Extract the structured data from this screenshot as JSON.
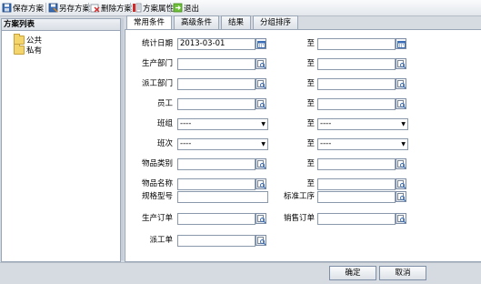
{
  "toolbar": {
    "save_label": "保存方案",
    "save_as_label": "另存方案",
    "delete_label": "删除方案",
    "props_label": "方案属性",
    "exit_label": "退出"
  },
  "sidebar": {
    "title": "方案列表",
    "items": [
      {
        "label": "公共"
      },
      {
        "label": "私有"
      }
    ]
  },
  "tabs": [
    {
      "label": "常用条件",
      "active": true
    },
    {
      "label": "高级条件",
      "active": false
    },
    {
      "label": "结果",
      "active": false
    },
    {
      "label": "分组排序",
      "active": false
    }
  ],
  "form": {
    "stat_date": {
      "label": "统计日期",
      "value": "2013-03-01",
      "to_label": "至",
      "to_value": ""
    },
    "prod_dept": {
      "label": "生产部门",
      "value": "",
      "to_label": "至",
      "to_value": ""
    },
    "dispatch_dept": {
      "label": "派工部门",
      "value": "",
      "to_label": "至",
      "to_value": ""
    },
    "employee": {
      "label": "员工",
      "value": "",
      "to_label": "至",
      "to_value": ""
    },
    "team": {
      "label": "班组",
      "value": "----",
      "to_label": "至",
      "to_value": "----"
    },
    "shift": {
      "label": "班次",
      "value": "----",
      "to_label": "至",
      "to_value": "----"
    },
    "item_category": {
      "label": "物品类别",
      "value": "",
      "to_label": "至",
      "to_value": ""
    },
    "item_name": {
      "label": "物品名称",
      "value": "",
      "to_label": "至",
      "to_value": ""
    },
    "spec_model": {
      "label": "规格型号",
      "value": "",
      "std_process_label": "标准工序",
      "std_process_value": ""
    },
    "prod_order": {
      "label": "生产订单",
      "value": "",
      "sales_order_label": "销售订单",
      "sales_order_value": ""
    },
    "dispatch_order": {
      "label": "派工单",
      "value": ""
    }
  },
  "footer": {
    "ok_label": "确定",
    "cancel_label": "取消"
  }
}
